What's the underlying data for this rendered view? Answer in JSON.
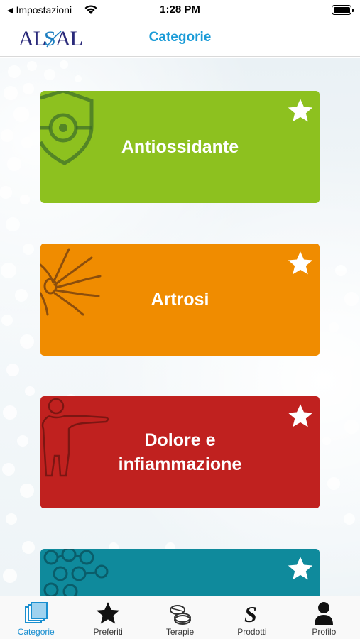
{
  "status_bar": {
    "back_label": "Impostazioni",
    "time": "1:28 PM"
  },
  "nav": {
    "logo_text": "ALSAL",
    "title": "Categorie"
  },
  "categories": [
    {
      "label": "Antiossidante",
      "color": "#8dc11f"
    },
    {
      "label": "Artrosi",
      "color": "#f08c00"
    },
    {
      "label": "Dolore e infiammazione",
      "color": "#c0211f"
    },
    {
      "label": "",
      "color": "#0f8a9c"
    }
  ],
  "tabs": [
    {
      "label": "Categorie",
      "icon": "layers-icon",
      "active": true
    },
    {
      "label": "Preferiti",
      "icon": "star-icon",
      "active": false
    },
    {
      "label": "Terapie",
      "icon": "pills-icon",
      "active": false
    },
    {
      "label": "Prodotti",
      "icon": "s-icon",
      "active": false
    },
    {
      "label": "Profilo",
      "icon": "person-icon",
      "active": false
    }
  ],
  "colors": {
    "accent": "#1a9bd7",
    "logo": "#2a2a7a"
  }
}
